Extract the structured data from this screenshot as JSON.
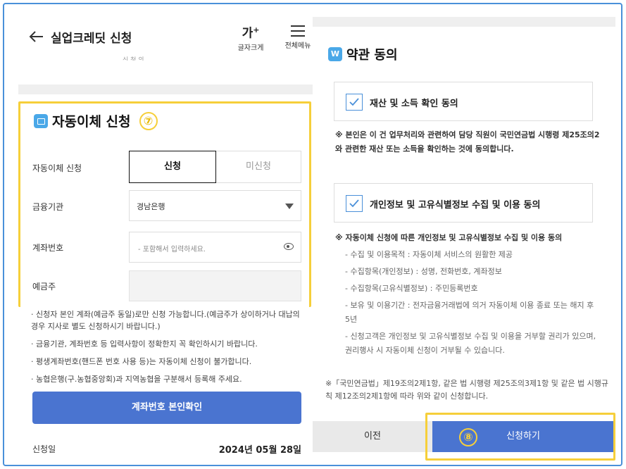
{
  "header": {
    "title": "실업크레딧 신청",
    "font_size_label": "글자크게",
    "font_glyph": "가",
    "font_glyph_sup": "+",
    "menu_label": "전체메뉴",
    "cut_text": "신 청 의"
  },
  "autopay": {
    "section_title": "자동이체 신청",
    "step_number": "⑦",
    "rows": {
      "apply_label": "자동이체 신청",
      "apply_on": "신청",
      "apply_off": "미신청",
      "bank_label": "금융기관",
      "bank_value": "경남은행",
      "account_label": "계좌번호",
      "account_placeholder": "- 포함해서 입력하세요.",
      "holder_label": "예금주"
    },
    "notes": [
      "· 신청자 본인 계좌(예금주 동일)로만 신청 가능합니다.(예금주가 상이하거나 대납의 경우 지사로 별도 신청하시기 바랍니다.)",
      "· 금융기관, 계좌번호 등 입력사항이 정확한지 꼭 확인하시기 바랍니다.",
      "· 평생계좌번호(핸드폰 번호 사용 등)는 자동이체 신청이 불가합니다.",
      "· 농협은행(구.농협중앙회)과 지역농협을 구분해서 등록해 주세요."
    ],
    "verify_button": "계좌번호 본인확인",
    "date_label": "신청일",
    "date_value": "2024년 05월 28일"
  },
  "terms": {
    "section_title": "약관 동의",
    "icon_letter": "W",
    "agree1_label": "재산 및 소득 확인 동의",
    "agree1_note": "※ 본인은 이 건 업무처리와 관련하여 담당 직원이 국민연금법 시행령 제25조의2와 관련한 재산 또는 소득을 확인하는 것에 동의합니다.",
    "agree2_label": "개인정보 및 고유식별정보 수집 및 이용 동의",
    "agree2_note": "※ 자동이체 신청에 따른 개인정보 및 고유식별정보 수집 및 이용 동의",
    "agree2_items": [
      "- 수집 및 이용목적 : 자동이체 서비스의 원활한 제공",
      "- 수집항목(개인정보) : 성명, 전화번호, 계좌정보",
      "- 수집항목(고유식별정보) : 주민등록번호",
      "- 보유 및 이용기간 : 전자금융거래법에 의거 자동이체 이용 종료 또는 해지 후 5년",
      "- 신청고객은 개인정보 및 고유식별정보 수집 및 이용을 거부할 권리가 있으며, 권리행사 시 자동이체 신청이 거부될 수 있습니다."
    ],
    "footer": "※「국민연금법」제19조의2제1항, 같은 법 시행령 제25조의3제1항 및 같은 법 시행규칙 제12조의2제1항에 따라 위와 같이 신청합니다.",
    "prev_button": "이전",
    "apply_button": "신청하기",
    "step_number": "⑧"
  },
  "colors": {
    "accent_blue": "#4a74d0",
    "highlight_yellow": "#f6cf3a",
    "icon_blue": "#4aa8e8"
  }
}
